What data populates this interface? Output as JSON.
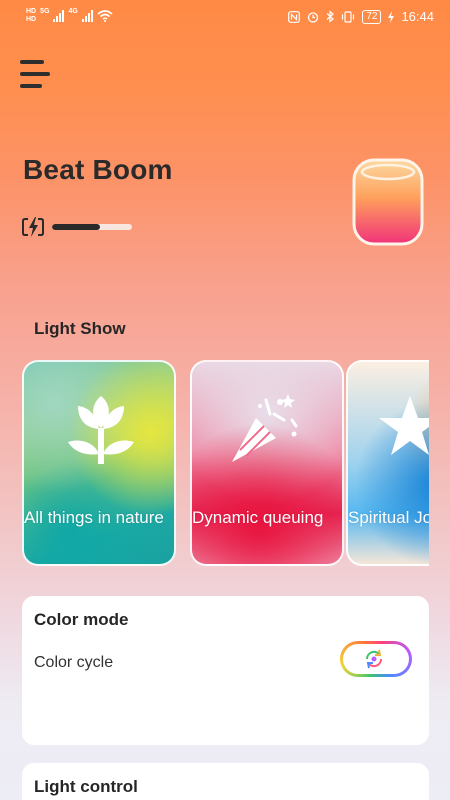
{
  "status_bar": {
    "left_badges": [
      "HD",
      "HD"
    ],
    "network_1": "5G",
    "network_2": "4G",
    "icons": [
      "nfc-icon",
      "alarm-icon",
      "bluetooth-icon",
      "vibrate-icon",
      "battery-icon",
      "charging-icon"
    ],
    "battery": "72",
    "time": "16:44"
  },
  "header": {
    "menu_icon": "hamburger-menu-icon",
    "device_name": "Beat Boom",
    "battery_level": 0.6,
    "battery_icon": "charging-battery-icon"
  },
  "light_show": {
    "title": "Light Show",
    "cards": [
      {
        "label": "All things in nature",
        "icon": "tulip-icon"
      },
      {
        "label": "Dynamic queuing",
        "icon": "party-popper-icon"
      },
      {
        "label": "Spiritual Jo",
        "icon": "star-icon"
      }
    ]
  },
  "color_mode": {
    "title": "Color mode",
    "cycle_label": "Color cycle",
    "toggle_icon": "cycle-icon",
    "toggle_on": false
  },
  "light_control": {
    "title": "Light control"
  },
  "colors": {
    "background_top": "#ff8a45",
    "text_dark": "#2a2a2a"
  }
}
